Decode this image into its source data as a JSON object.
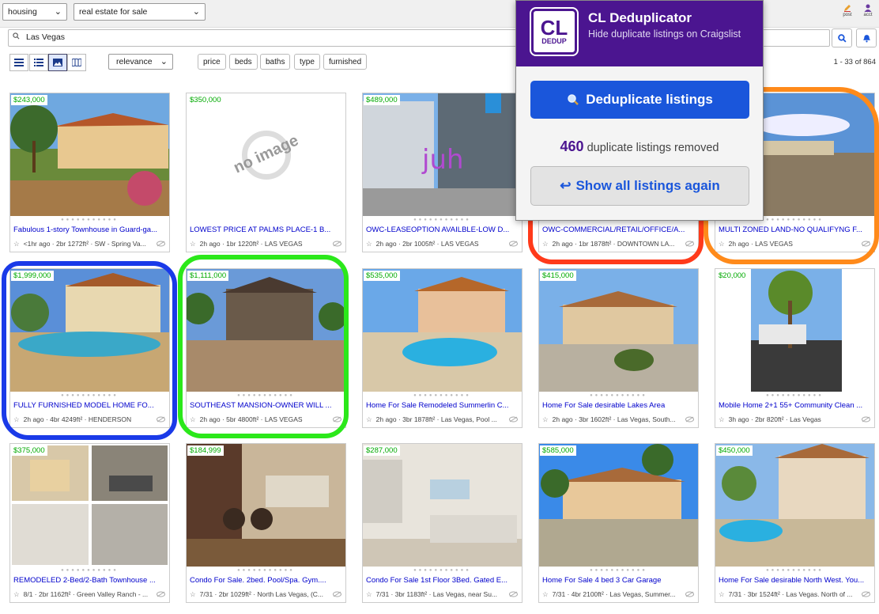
{
  "topbar": {
    "category": "housing",
    "subcategory": "real estate for sale",
    "post_label": "post",
    "account_label": "acct"
  },
  "search": {
    "value": "Las Vegas"
  },
  "toolbar": {
    "sort": "relevance",
    "filters": [
      "price",
      "beds",
      "baths",
      "type",
      "furnished"
    ],
    "result_count": "1 - 33 of 864"
  },
  "listings": [
    {
      "price": "$243,000",
      "title": "Fabulous 1-story Townhouse in Guard-ga...",
      "meta": "<1hr ago · 2br 1272ft² · SW - Spring Va..."
    },
    {
      "price": "$350,000",
      "title": "LOWEST PRICE AT PALMS PLACE-1 B...",
      "meta": "2h ago · 1br 1220ft² · LAS VEGAS",
      "no_image": "no image"
    },
    {
      "price": "$489,000",
      "title": "OWC-LEASEOPTION AVAILBLE-LOW D...",
      "meta": "2h ago · 2br 1005ft² · LAS VEGAS"
    },
    {
      "price": "",
      "title": "OWC-COMMERCIAL/RETAIL/OFFICE/A...",
      "meta": "2h ago · 1br 1878ft² · DOWNTOWN LA..."
    },
    {
      "price": "",
      "title": "MULTI ZONED LAND-NO QUALIFYNG F...",
      "meta": "2h ago · LAS VEGAS"
    },
    {
      "price": "$1,999,000",
      "title": "FULLY FURNISHED MODEL HOME FO...",
      "meta": "2h ago · 4br 4249ft² · HENDERSON"
    },
    {
      "price": "$1,111,000",
      "title": "SOUTHEAST MANSION-OWNER WILL ...",
      "meta": "2h ago · 5br 4800ft² · LAS VEGAS"
    },
    {
      "price": "$535,000",
      "title": "Home For Sale Remodeled Summerlin C...",
      "meta": "2h ago · 3br 1878ft² · Las Vegas, Pool ..."
    },
    {
      "price": "$415,000",
      "title": "Home For Sale desirable Lakes Area",
      "meta": "2h ago · 3br 1602ft² · Las Vegas, South..."
    },
    {
      "price": "$20,000",
      "title": "Mobile Home 2+1 55+ Community Clean ...",
      "meta": "3h ago · 2br 820ft² · Las Vegas"
    },
    {
      "price": "$375,000",
      "title": "REMODELED 2-Bed/2-Bath Townhouse ...",
      "meta": "8/1 · 2br 1162ft² · Green Valley Ranch - ..."
    },
    {
      "price": "$184,999",
      "title": "Condo For Sale. 2bed. Pool/Spa. Gym....",
      "meta": "7/31 · 2br 1029ft² · North Las Vegas, (C..."
    },
    {
      "price": "$287,000",
      "title": "Condo For Sale 1st Floor 3Bed. Gated E...",
      "meta": "7/31 · 3br 1183ft² · Las Vegas, near Su..."
    },
    {
      "price": "$585,000",
      "title": "Home For Sale 4 bed 3 Car Garage",
      "meta": "7/31 · 4br 2100ft² · Las Vegas, Summer..."
    },
    {
      "price": "$450,000",
      "title": "Home For Sale desirable North West. You...",
      "meta": "7/31 · 3br 1524ft² · Las Vegas. North of ..."
    }
  ],
  "popup": {
    "logo_top": "CL",
    "logo_bottom": "DEDUP",
    "title": "CL Deduplicator",
    "subtitle": "Hide duplicate listings on Craigslist",
    "dedupe_button": "Deduplicate listings",
    "removed_count": "460",
    "removed_text": "duplicate listings removed",
    "show_all_button": "Show all listings again"
  },
  "colors": {
    "accent_purple": "#4b1590",
    "button_blue": "#1a56db",
    "price_green": "#00aa00",
    "link_blue": "#0000cc"
  }
}
